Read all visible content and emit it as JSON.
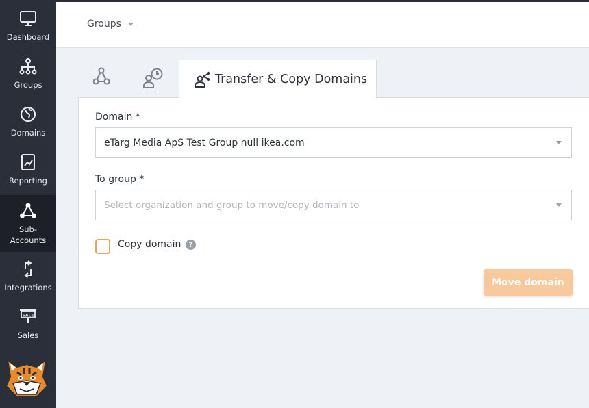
{
  "sidebar": {
    "items": [
      {
        "label": "Dashboard",
        "icon": "monitor-icon"
      },
      {
        "label": "Groups",
        "icon": "hierarchy-icon"
      },
      {
        "label": "Domains",
        "icon": "globe-icon"
      },
      {
        "label": "Reporting",
        "icon": "chart-icon"
      },
      {
        "label": "Sub-\nAccounts",
        "icon": "network-icon",
        "active": true
      },
      {
        "label": "Integrations",
        "icon": "arrows-icon"
      },
      {
        "label": "Sales",
        "icon": "sale-sign-icon"
      }
    ]
  },
  "header": {
    "groups_label": "Groups"
  },
  "tabs": {
    "active_label": "Transfer & Copy Domains",
    "icons": [
      "network-icon",
      "user-clock-icon",
      "user-share-icon"
    ]
  },
  "form": {
    "domain_label": "Domain *",
    "domain_value": "eTarg Media ApS Test Group null ikea.com",
    "to_group_label": "To group *",
    "to_group_placeholder": "Select organization and group to move/copy domain to",
    "copy_label": "Copy domain",
    "help_glyph": "?",
    "move_button": "Move domain"
  },
  "colors": {
    "sidebar": "#2b2f3a",
    "accent": "#f0a35e",
    "button_disabled": "#f8c99d"
  }
}
